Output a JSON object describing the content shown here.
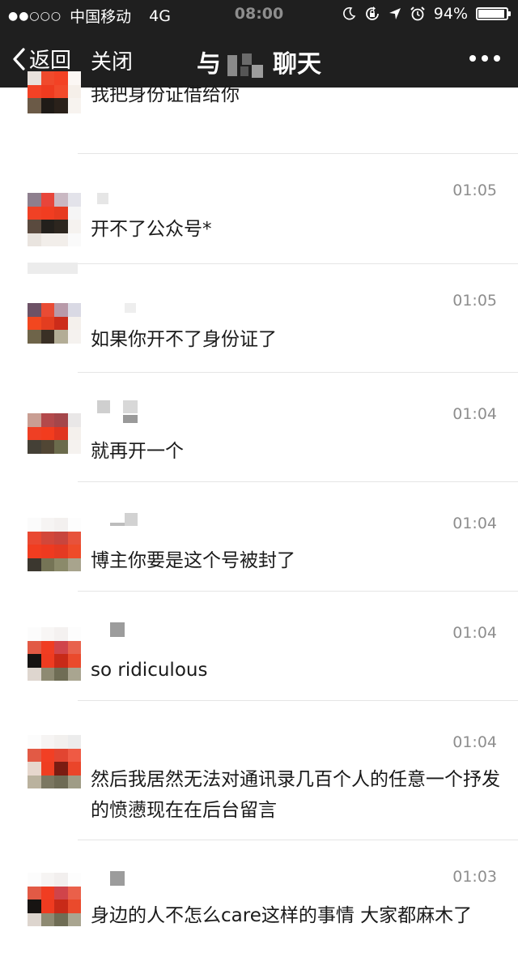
{
  "status_bar": {
    "signal_dots": "●●○○○",
    "carrier": "中国移动",
    "network": "4G",
    "time": "08:00",
    "battery_percent_label": "94%",
    "battery_level": 0.94,
    "icons": [
      "moon-icon",
      "rotation-lock-icon",
      "location-arrow-icon",
      "alarm-icon"
    ]
  },
  "nav": {
    "back_label": "返回",
    "close_label": "关闭",
    "title_prefix": "与",
    "title_suffix": "聊天"
  },
  "messages": [
    {
      "time": "",
      "text": "我把身份证借给你"
    },
    {
      "time": "01:05",
      "text": "开不了公众号*"
    },
    {
      "time": "01:05",
      "text": "如果你开不了身份证了"
    },
    {
      "time": "01:04",
      "text": "就再开一个"
    },
    {
      "time": "01:04",
      "text": "博主你要是这个号被封了"
    },
    {
      "time": "01:04",
      "text": "so ridiculous"
    },
    {
      "time": "01:04",
      "text": "然后我居然无法对通讯录几百个人的任意一个抒发的愤懑现在在后台留言"
    },
    {
      "time": "01:03",
      "text": "身边的人不怎么care这样的事情 大家都麻木了"
    }
  ]
}
